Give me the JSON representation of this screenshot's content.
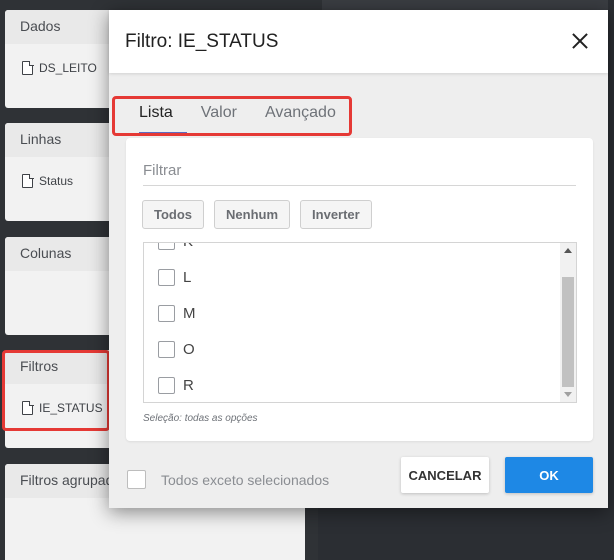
{
  "sidebar": {
    "sections": [
      {
        "title": "Dados",
        "items": [
          "DS_LEITO"
        ]
      },
      {
        "title": "Linhas",
        "items": [
          "Status"
        ]
      },
      {
        "title": "Colunas",
        "items": []
      },
      {
        "title": "Filtros",
        "items": [
          "IE_STATUS"
        ]
      },
      {
        "title": "Filtros agrupados",
        "items": []
      }
    ]
  },
  "dialog": {
    "title": "Filtro: IE_STATUS",
    "tabs": [
      {
        "label": "Lista",
        "active": true
      },
      {
        "label": "Valor",
        "active": false
      },
      {
        "label": "Avançado",
        "active": false
      }
    ],
    "filter_placeholder": "Filtrar",
    "buttons": {
      "all": "Todos",
      "none": "Nenhum",
      "invert": "Inverter"
    },
    "list_items": [
      {
        "label": "K",
        "checked": false
      },
      {
        "label": "L",
        "checked": false
      },
      {
        "label": "M",
        "checked": false
      },
      {
        "label": "O",
        "checked": false
      },
      {
        "label": "R",
        "checked": false
      }
    ],
    "selection_note": "Seleção: todas as opções",
    "except_selected_label": "Todos exceto selecionados",
    "cancel_label": "CANCELAR",
    "ok_label": "OK"
  },
  "colors": {
    "accent": "#1e88e5",
    "highlight": "#e53935",
    "tab_underline": "#5c6bc0"
  }
}
